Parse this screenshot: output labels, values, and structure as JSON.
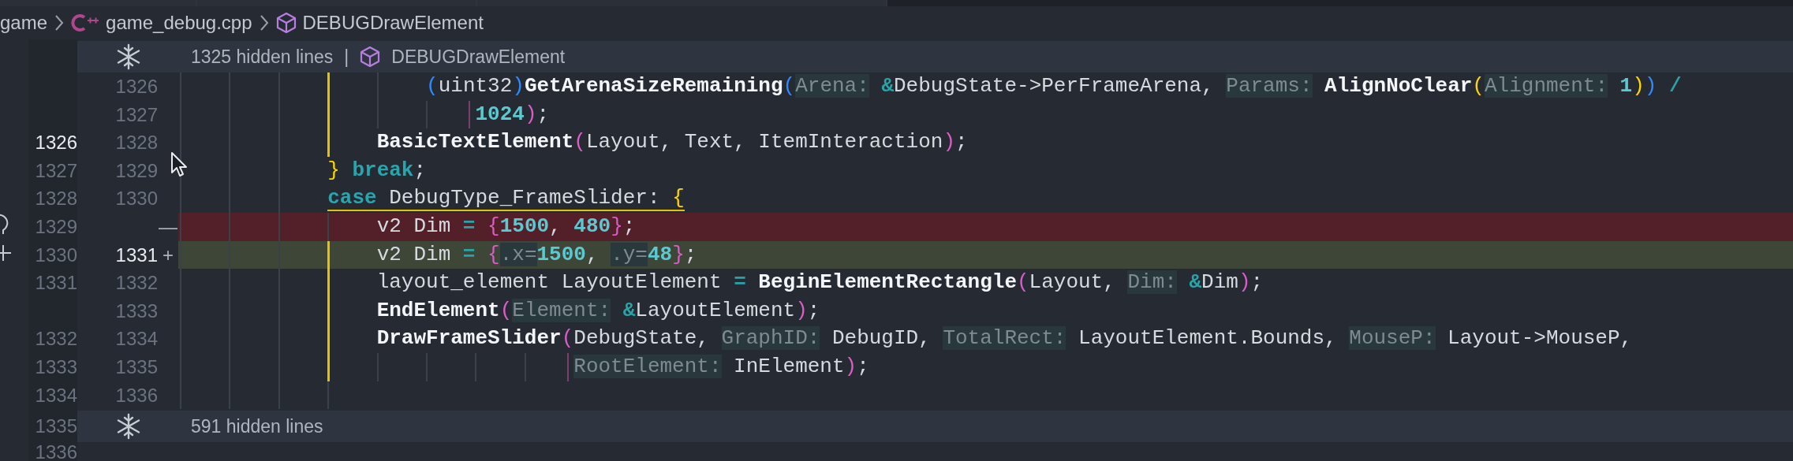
{
  "breadcrumb": [
    {
      "kind": "folder",
      "label": "game"
    },
    {
      "kind": "file",
      "label": "game_debug.cpp"
    },
    {
      "kind": "symbol",
      "label": "DEBUGDrawElement"
    }
  ],
  "rows": [
    {
      "kind": "folded",
      "label": "1325 hidden lines",
      "separator": "|",
      "symbol": "DEBUGDrawElement"
    },
    {
      "kind": "context",
      "new": "1326",
      "new_lit": false,
      "bracket_guide": true,
      "continuation": false,
      "tokens": [
        {
          "kind": "bracket",
          "color": "#2f8cff",
          "text": "                    ("
        },
        {
          "kind": "text",
          "text": "uint32"
        },
        {
          "kind": "bracket",
          "color": "#2f8cff",
          "text": ")"
        },
        {
          "kind": "fn",
          "text": "GetArenaSizeRemaining"
        },
        {
          "kind": "bracket",
          "color": "#2f8cff",
          "text": "("
        },
        {
          "kind": "hint",
          "text": "Arena:"
        },
        {
          "kind": "op",
          "text": " &"
        },
        {
          "kind": "text",
          "text": "DebugState->PerFrameArena, "
        },
        {
          "kind": "hint",
          "text": "Params:"
        },
        {
          "kind": "fn",
          "text": " AlignNoClear"
        },
        {
          "kind": "bracket",
          "color": "#ffd700",
          "text": "("
        },
        {
          "kind": "hint",
          "text": "Alignment:"
        },
        {
          "kind": "num",
          "text": " 1"
        },
        {
          "kind": "bracket",
          "color": "#ffd700",
          "text": ")"
        },
        {
          "kind": "bracket",
          "color": "#2f8cff",
          "text": ")"
        },
        {
          "kind": "op",
          "text": " /"
        }
      ]
    },
    {
      "kind": "context",
      "new": "1327",
      "new_lit": false,
      "bracket_guide": true,
      "continuation": true,
      "tokens": [
        {
          "kind": "num",
          "text": "                        1024"
        },
        {
          "kind": "bracket",
          "color": "#d95ec8",
          "text": ")"
        },
        {
          "kind": "text",
          "text": ";"
        }
      ]
    },
    {
      "kind": "context",
      "old": "1326",
      "old_lit": true,
      "new": "1328",
      "new_lit": false,
      "bracket_guide": true,
      "continuation": false,
      "tokens": [
        {
          "kind": "fn",
          "text": "                BasicTextElement"
        },
        {
          "kind": "bracket",
          "color": "#d95ec8",
          "text": "("
        },
        {
          "kind": "text",
          "text": "Layout, Text, ItemInteraction"
        },
        {
          "kind": "bracket",
          "color": "#d95ec8",
          "text": ")"
        },
        {
          "kind": "text",
          "text": ";"
        }
      ]
    },
    {
      "kind": "context",
      "old": "1327",
      "old_lit": false,
      "new": "1329",
      "new_lit": false,
      "bracket_guide": false,
      "continuation": false,
      "tokens": [
        {
          "kind": "bracket",
          "color": "#ffd700",
          "text": "            }"
        },
        {
          "kind": "kw",
          "text": " break"
        },
        {
          "kind": "text",
          "text": ";"
        }
      ]
    },
    {
      "kind": "context",
      "old": "1328",
      "old_lit": false,
      "new": "1330",
      "new_lit": false,
      "bracket_guide": false,
      "continuation": false,
      "underline": true,
      "tokens": [
        {
          "kind": "kw",
          "text": "            case"
        },
        {
          "kind": "text",
          "text": " DebugType_FrameSlider: "
        },
        {
          "kind": "bracket",
          "color": "#ffd700",
          "text": "{"
        }
      ]
    },
    {
      "kind": "removed",
      "old": "1329",
      "old_lit": false,
      "marker": "—",
      "edge": {
        "kind": "bulb"
      },
      "bracket_guide": false,
      "continuation": false,
      "tokens": [
        {
          "kind": "text",
          "text": "                v2 Dim "
        },
        {
          "kind": "op",
          "text": "="
        },
        {
          "kind": "bracket",
          "color": "#d95ec8",
          "text": " {"
        },
        {
          "kind": "num",
          "text": "1500"
        },
        {
          "kind": "text",
          "text": ", "
        },
        {
          "kind": "num",
          "text": "480"
        },
        {
          "kind": "bracket",
          "color": "#d95ec8",
          "text": "}"
        },
        {
          "kind": "text",
          "text": ";"
        }
      ]
    },
    {
      "kind": "added",
      "old": "1330",
      "old_lit": false,
      "new": "1331",
      "new_lit": true,
      "marker": "+",
      "edge": {
        "kind": "plus"
      },
      "bracket_guide": true,
      "continuation": false,
      "tokens": [
        {
          "kind": "text",
          "text": "                v2 Dim "
        },
        {
          "kind": "op",
          "text": "="
        },
        {
          "kind": "bracket",
          "color": "#d95ec8",
          "text": " {"
        },
        {
          "kind": "hint",
          "text": ".x="
        },
        {
          "kind": "num",
          "text": "1500"
        },
        {
          "kind": "text",
          "text": ", "
        },
        {
          "kind": "hint",
          "text": ".y="
        },
        {
          "kind": "num",
          "text": "48"
        },
        {
          "kind": "bracket",
          "color": "#d95ec8",
          "text": "}"
        },
        {
          "kind": "text",
          "text": ";"
        }
      ]
    },
    {
      "kind": "context",
      "old": "1331",
      "old_lit": false,
      "new": "1332",
      "new_lit": false,
      "bracket_guide": true,
      "continuation": false,
      "tokens": [
        {
          "kind": "text",
          "text": "                layout_element LayoutElement "
        },
        {
          "kind": "op",
          "text": "="
        },
        {
          "kind": "fn",
          "text": " BeginElementRectangle"
        },
        {
          "kind": "bracket",
          "color": "#d95ec8",
          "text": "("
        },
        {
          "kind": "text",
          "text": "Layout, "
        },
        {
          "kind": "hint",
          "text": "Dim:"
        },
        {
          "kind": "op",
          "text": " &"
        },
        {
          "kind": "text",
          "text": "Dim"
        },
        {
          "kind": "bracket",
          "color": "#d95ec8",
          "text": ")"
        },
        {
          "kind": "text",
          "text": ";"
        }
      ]
    },
    {
      "kind": "context",
      "new": "1333",
      "new_lit": false,
      "bracket_guide": true,
      "continuation": false,
      "tokens": [
        {
          "kind": "fn",
          "text": "                EndElement"
        },
        {
          "kind": "bracket",
          "color": "#d95ec8",
          "text": "("
        },
        {
          "kind": "hint",
          "text": "Element:"
        },
        {
          "kind": "op",
          "text": " &"
        },
        {
          "kind": "text",
          "text": "LayoutElement"
        },
        {
          "kind": "bracket",
          "color": "#d95ec8",
          "text": ")"
        },
        {
          "kind": "text",
          "text": ";"
        }
      ]
    },
    {
      "kind": "context",
      "old": "1332",
      "old_lit": false,
      "new": "1334",
      "new_lit": false,
      "bracket_guide": true,
      "continuation": false,
      "tokens": [
        {
          "kind": "fn",
          "text": "                DrawFrameSlider"
        },
        {
          "kind": "bracket",
          "color": "#d95ec8",
          "text": "("
        },
        {
          "kind": "text",
          "text": "DebugState, "
        },
        {
          "kind": "hint",
          "text": "GraphID:"
        },
        {
          "kind": "text",
          "text": " DebugID, "
        },
        {
          "kind": "hint",
          "text": "TotalRect:"
        },
        {
          "kind": "text",
          "text": " LayoutElement.Bounds, "
        },
        {
          "kind": "hint",
          "text": "MouseP:"
        },
        {
          "kind": "text",
          "text": " Layout->MouseP,"
        }
      ]
    },
    {
      "kind": "context",
      "old": "1333",
      "old_lit": false,
      "new": "1335",
      "new_lit": false,
      "bracket_guide": true,
      "continuation": true,
      "tokens": [
        {
          "kind": "hint",
          "text": "                                RootElement:"
        },
        {
          "kind": "text",
          "text": " InElement"
        },
        {
          "kind": "bracket",
          "color": "#d95ec8",
          "text": ")"
        },
        {
          "kind": "text",
          "text": ";"
        }
      ]
    },
    {
      "kind": "blank",
      "old": "1334",
      "old_lit": false,
      "new": "1336",
      "new_lit": false
    },
    {
      "kind": "folded",
      "old": "1335",
      "label": "591 hidden lines"
    },
    {
      "kind": "tail",
      "old": "1336",
      "old_lit": false
    }
  ]
}
